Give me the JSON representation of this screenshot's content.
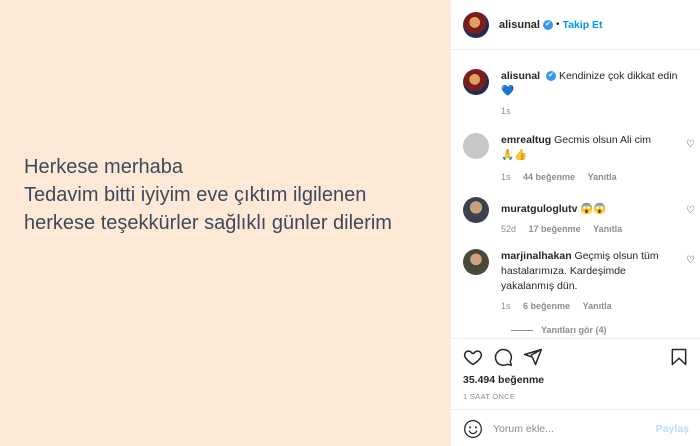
{
  "post": {
    "lines": [
      "Herkese merhaba",
      "Tedavim bitti iyiyim eve çıktım ilgilenen",
      "herkese teşekkürler sağlıklı günler dilerim"
    ]
  },
  "header": {
    "username": "alisunal",
    "verified_mark": "✔",
    "separator": "•",
    "follow_label": "Takip Et"
  },
  "caption": {
    "username": "alisunal",
    "text": "Kendinize çok dikkat edin",
    "emoji": "💙",
    "time": "1s"
  },
  "comments": [
    {
      "username": "emrealtug",
      "text": "Gecmis olsun Ali cim",
      "emoji": "🙏👍",
      "time": "1s",
      "likes": "44 beğenme",
      "reply": "Yanıtla"
    },
    {
      "username": "muratguloglutv",
      "text": "",
      "emoji": "😱😱",
      "time": "52d",
      "likes": "17 beğenme",
      "reply": "Yanıtla"
    },
    {
      "username": "marjinalhakan",
      "text": "Geçmiş olsun tüm hastalarımıza. Kardeşimde yakalanmış dün.",
      "emoji": "",
      "time": "1s",
      "likes": "6 beğenme",
      "reply": "Yanıtla"
    }
  ],
  "replies_label": "Yanıtları gör (4)",
  "likes_total": "35.494 beğenme",
  "posted_ago": "1 SAAT ÖNCE",
  "comment_input": {
    "placeholder": "Yorum ekle..."
  },
  "share_label": "Paylaş",
  "icons": [
    "heart-icon",
    "comment-icon",
    "share-icon",
    "bookmark-icon",
    "emoji-icon"
  ],
  "colors": {
    "accent": "#0095f6",
    "verified": "#3897f0",
    "background": "#fde9d6"
  }
}
